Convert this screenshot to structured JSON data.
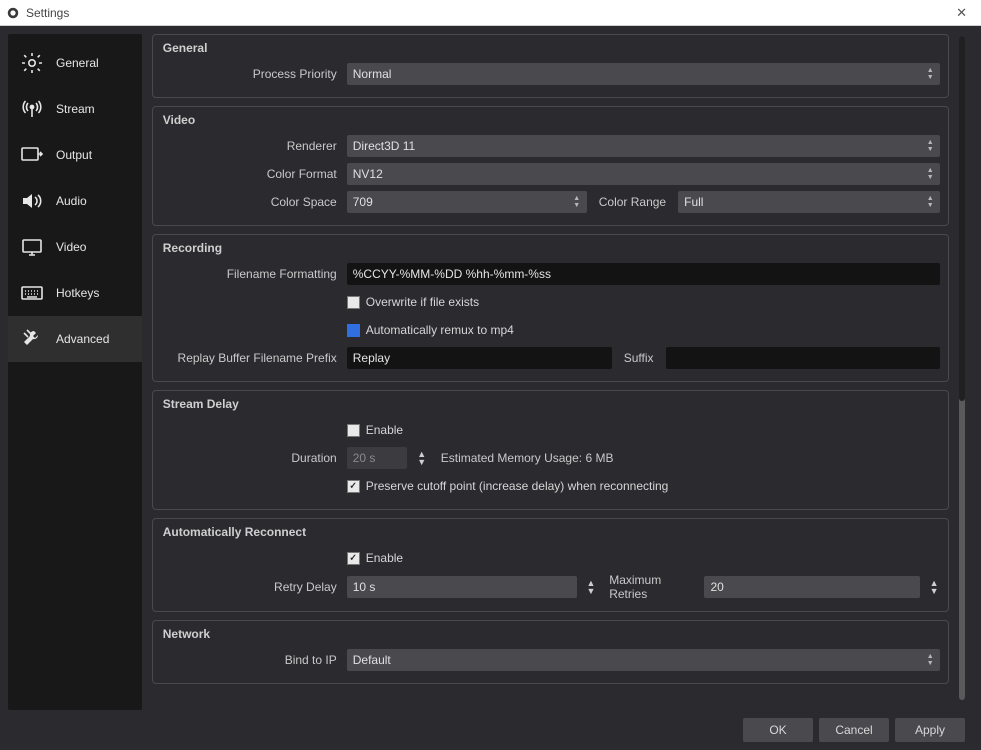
{
  "window": {
    "title": "Settings"
  },
  "sidebar": {
    "items": [
      {
        "label": "General",
        "id": "general"
      },
      {
        "label": "Stream",
        "id": "stream"
      },
      {
        "label": "Output",
        "id": "output"
      },
      {
        "label": "Audio",
        "id": "audio"
      },
      {
        "label": "Video",
        "id": "video"
      },
      {
        "label": "Hotkeys",
        "id": "hotkeys"
      },
      {
        "label": "Advanced",
        "id": "advanced"
      }
    ],
    "active_index": 6
  },
  "groups": {
    "general": {
      "title": "General",
      "process_priority_label": "Process Priority",
      "process_priority_value": "Normal"
    },
    "video": {
      "title": "Video",
      "renderer_label": "Renderer",
      "renderer_value": "Direct3D 11",
      "color_format_label": "Color Format",
      "color_format_value": "NV12",
      "color_space_label": "Color Space",
      "color_space_value": "709",
      "color_range_label": "Color Range",
      "color_range_value": "Full"
    },
    "recording": {
      "title": "Recording",
      "filename_formatting_label": "Filename Formatting",
      "filename_formatting_value": "%CCYY-%MM-%DD %hh-%mm-%ss",
      "overwrite_label": "Overwrite if file exists",
      "overwrite_checked": false,
      "auto_remux_label": "Automatically remux to mp4",
      "auto_remux_checked": false,
      "replay_prefix_label": "Replay Buffer Filename Prefix",
      "replay_prefix_value": "Replay",
      "suffix_label": "Suffix",
      "suffix_value": ""
    },
    "stream_delay": {
      "title": "Stream Delay",
      "enable_label": "Enable",
      "enable_checked": false,
      "duration_label": "Duration",
      "duration_value": "20 s",
      "estimate_label": "Estimated Memory Usage: 6 MB",
      "preserve_label": "Preserve cutoff point (increase delay) when reconnecting",
      "preserve_checked": true
    },
    "auto_reconnect": {
      "title": "Automatically Reconnect",
      "enable_label": "Enable",
      "enable_checked": true,
      "retry_delay_label": "Retry Delay",
      "retry_delay_value": "10 s",
      "max_retries_label": "Maximum Retries",
      "max_retries_value": "20"
    },
    "network": {
      "title": "Network",
      "bind_label": "Bind to IP",
      "bind_value": "Default"
    }
  },
  "footer": {
    "ok": "OK",
    "cancel": "Cancel",
    "apply": "Apply"
  }
}
